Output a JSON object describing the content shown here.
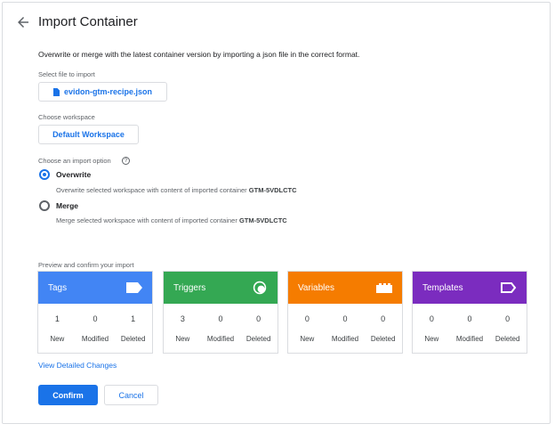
{
  "header": {
    "title": "Import Container",
    "back_icon": "arrow-left-icon"
  },
  "description": "Overwrite or merge with the latest container version by importing a json file in the correct format.",
  "file": {
    "label": "Select file to import",
    "filename": "evidon-gtm-recipe.json",
    "icon": "file-icon"
  },
  "workspace": {
    "label": "Choose workspace",
    "value": "Default Workspace"
  },
  "import_option": {
    "label": "Choose an import option",
    "help_icon": "?",
    "selected": "overwrite",
    "overwrite": {
      "name": "Overwrite",
      "desc": "Overwrite selected workspace with content of imported container",
      "container": "GTM-5VDLCTC"
    },
    "merge": {
      "name": "Merge",
      "desc": "Merge selected workspace with content of imported container",
      "container": "GTM-5VDLCTC"
    }
  },
  "preview": {
    "label": "Preview and confirm your import",
    "stat_labels": {
      "new": "New",
      "modified": "Modified",
      "deleted": "Deleted"
    },
    "cards": [
      {
        "name": "Tags",
        "color": "#4285f4",
        "icon": "tag-icon",
        "new": "1",
        "modified": "0",
        "deleted": "1"
      },
      {
        "name": "Triggers",
        "color": "#34a853",
        "icon": "trigger-icon",
        "new": "3",
        "modified": "0",
        "deleted": "0"
      },
      {
        "name": "Variables",
        "color": "#f57c00",
        "icon": "variable-icon",
        "new": "0",
        "modified": "0",
        "deleted": "0"
      },
      {
        "name": "Templates",
        "color": "#7b2cbf",
        "icon": "template-icon",
        "new": "0",
        "modified": "0",
        "deleted": "0"
      }
    ]
  },
  "links": {
    "view_changes": "View Detailed Changes"
  },
  "buttons": {
    "confirm": "Confirm",
    "cancel": "Cancel"
  },
  "colors": {
    "accent": "#1a73e8"
  }
}
